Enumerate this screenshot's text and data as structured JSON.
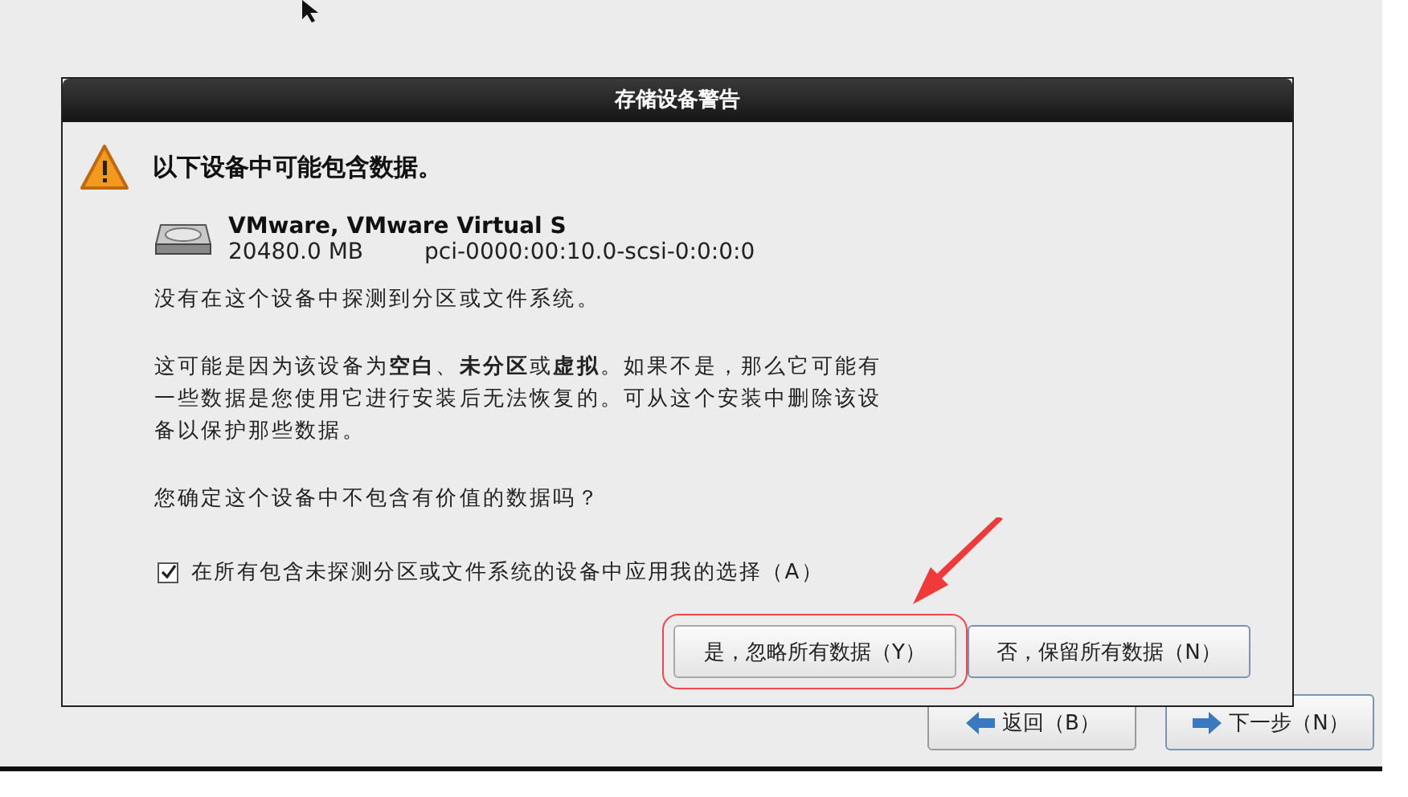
{
  "dialog": {
    "title": "存储设备警告",
    "heading": "以下设备中可能包含数据。",
    "device": {
      "name": "VMware, VMware Virtual S",
      "size": "20480.0 MB",
      "path": "pci-0000:00:10.0-scsi-0:0:0:0"
    },
    "paragraphs": [
      "没有在这个设备中探测到分区或文件系统。",
      "这可能是因为该设备为**空白**、**未分区**或**虚拟**。如果不是，那么它可能有一些数据是您使用它进行安装后无法恢复的。可从这个安装中删除该设备以保护那些数据。",
      "您确定这个设备中不包含有价值的数据吗？"
    ],
    "checkbox": {
      "label": "在所有包含未探测分区或文件系统的设备中应用我的选择（A）",
      "checked": true
    },
    "buttons": [
      {
        "label": "是，忽略所有数据（Y）",
        "highlighted": true
      },
      {
        "label": "否，保留所有数据（N）",
        "highlighted": false
      }
    ]
  },
  "nav_buttons": [
    {
      "label": "返回（B）",
      "kind": "back"
    },
    {
      "label": "下一步（N）",
      "kind": "next"
    }
  ]
}
